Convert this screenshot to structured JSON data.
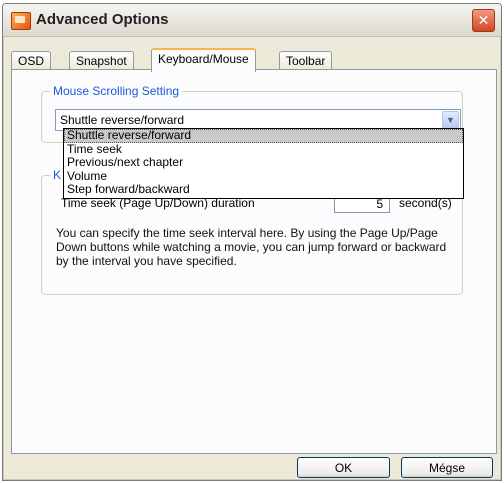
{
  "window": {
    "title": "Advanced Options",
    "close_glyph": "✕"
  },
  "tabs": [
    {
      "label": "OSD",
      "active": false
    },
    {
      "label": "Snapshot",
      "active": false
    },
    {
      "label": "Keyboard/Mouse",
      "active": true
    },
    {
      "label": "Toolbar",
      "active": false
    }
  ],
  "mouse_group": {
    "legend": "Mouse Scrolling Setting",
    "select_value": "Shuttle reverse/forward",
    "options": [
      "Shuttle reverse/forward",
      "Time seek",
      "Previous/next chapter",
      "Volume",
      "Step forward/backward"
    ],
    "selected_index": 0
  },
  "keyboard_group": {
    "legend_partial": "K",
    "seek_label": "Time seek (Page Up/Down) duration",
    "seek_value": "5",
    "seek_unit": "second(s)",
    "help_text": "You can specify the time seek interval here. By using the Page Up/Page Down buttons while watching a movie, you can jump forward or backward by the interval you have specified."
  },
  "buttons": {
    "ok": "OK",
    "cancel": "Mégse"
  },
  "icons": {
    "app": "app-icon",
    "close": "close-icon",
    "dropdown": "chevron-down-icon"
  },
  "colors": {
    "accent": "#1c5ad6",
    "tab_highlight": "#f7b64d",
    "close_red": "#d4461f"
  }
}
